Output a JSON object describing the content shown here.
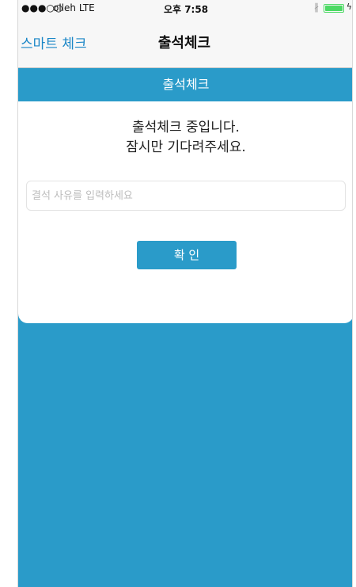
{
  "status_bar": {
    "signal": "●●●○○",
    "carrier": "olleh  LTE",
    "time": "오후 7:58",
    "bluetooth_icon": "bluetooth-icon",
    "battery_icon": "battery-icon",
    "charging_icon": "bolt-icon"
  },
  "nav": {
    "back_label": "스마트 체크",
    "title": "출석체크"
  },
  "section": {
    "header": "출석체크"
  },
  "card": {
    "message_line1": "출석체크 중입니다.",
    "message_line2": "잠시만 기다려주세요.",
    "reason_placeholder": "결석 사유를 입력하세요",
    "reason_value": "",
    "confirm_label": "확 인"
  },
  "colors": {
    "accent": "#2a9bc9",
    "nav_link": "#1a86c7",
    "battery": "#4cd964"
  }
}
